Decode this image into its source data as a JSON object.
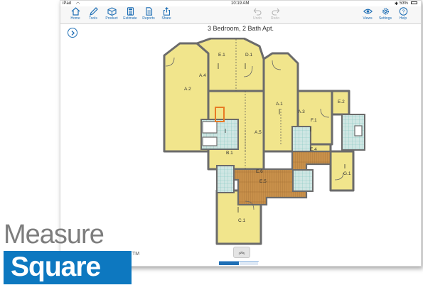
{
  "status": {
    "device": "iPad",
    "time": "10:19 AM",
    "battery": "53%"
  },
  "toolbar": {
    "home": "Home",
    "tools": "Tools",
    "product": "Product",
    "estimate": "Estimate",
    "reports": "Reports",
    "share": "Share",
    "undo": "Undo",
    "redo": "Redo",
    "views": "Views",
    "settings": "Settings",
    "help": "Help"
  },
  "plan": {
    "title": "3 Bedroom, 2 Bath Apt.",
    "rooms": {
      "e1": "E.1",
      "d1": "D.1",
      "a2": "A.2",
      "a4": "A.4",
      "a1": "A.1",
      "a3": "A.3",
      "f1": "F.1",
      "e2": "E.2",
      "b1": "B.1",
      "a5": "A.5",
      "c1": "C.1",
      "g1": "G.1",
      "e6": "E.6",
      "e5": "E.5",
      "e4": "E.4"
    },
    "colors": {
      "room": "#f1e58c",
      "wall": "#6b6b6b",
      "wood": "#c8904a",
      "tile": "#cfe6e3",
      "tile_line": "#7fc4bd",
      "highlight": "#e87a24"
    }
  },
  "logo": {
    "line1": "Measure",
    "line2": "Square",
    "tm": "TM"
  }
}
